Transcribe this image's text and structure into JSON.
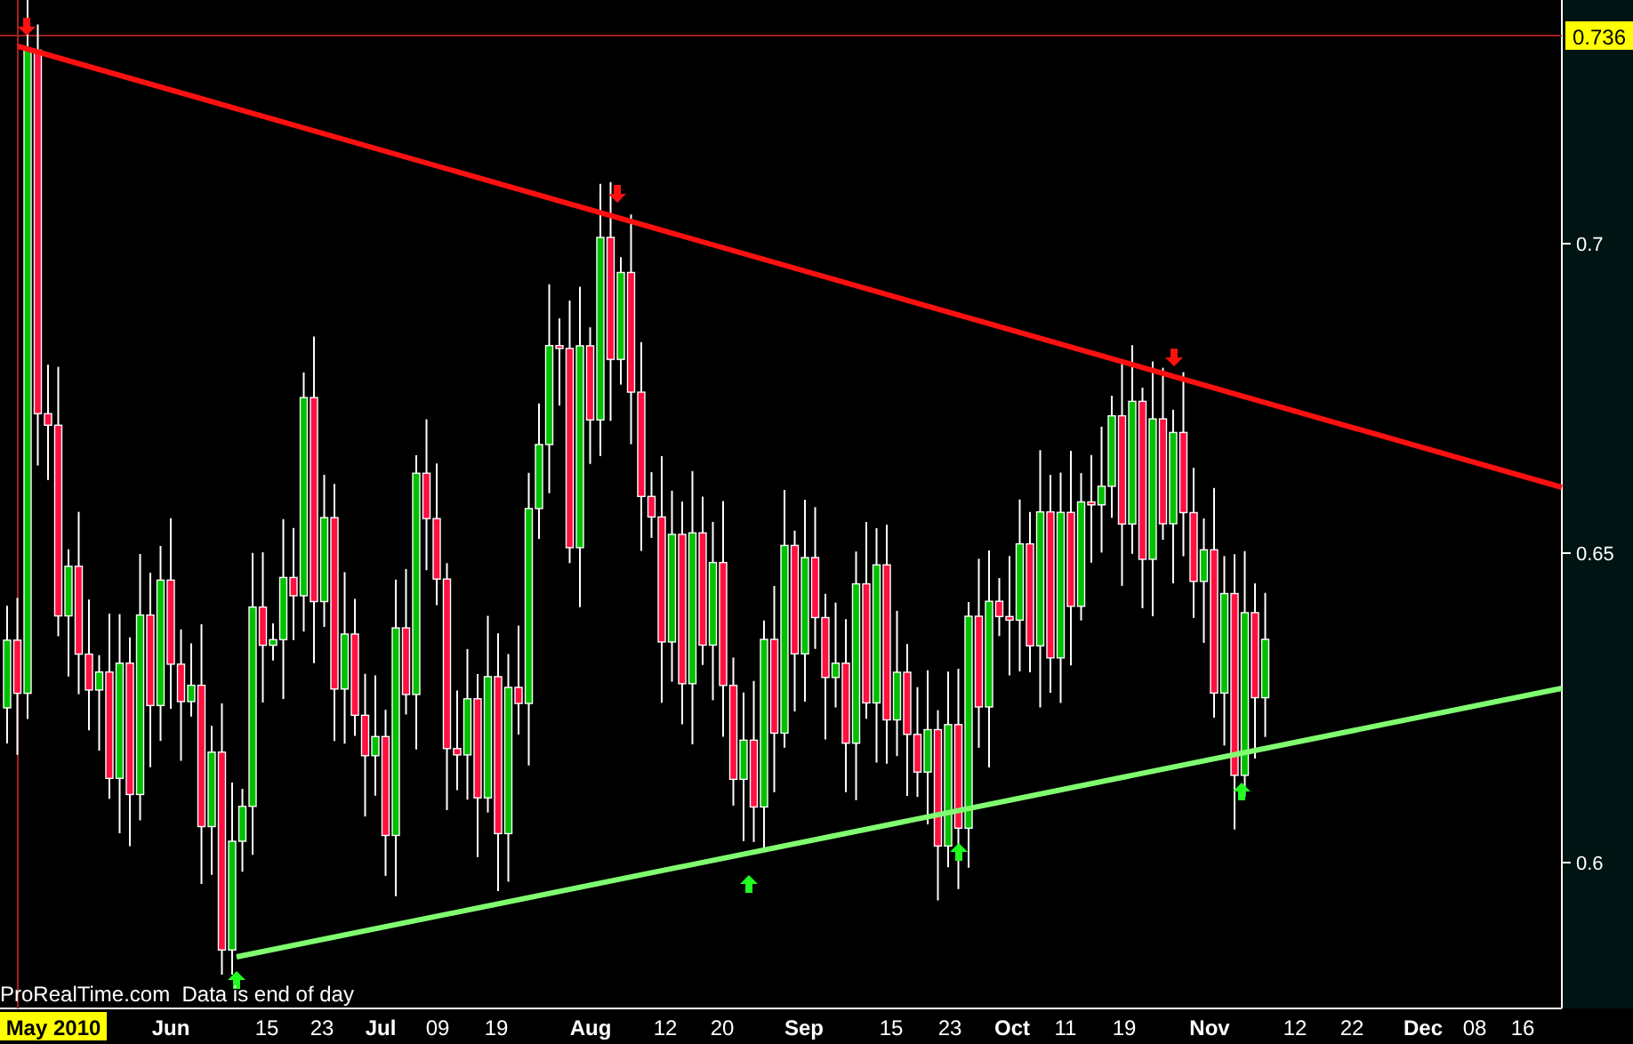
{
  "chart": {
    "price_tag": "0.736",
    "y_ticks": [
      {
        "label": "0.7"
      },
      {
        "label": "0.65"
      },
      {
        "label": "0.6"
      }
    ],
    "x_ticks": [
      {
        "label": "May 2010",
        "selected": true,
        "kind": "month"
      },
      {
        "label": "Jun",
        "selected": false,
        "kind": "month"
      },
      {
        "label": "15",
        "selected": false,
        "kind": "day"
      },
      {
        "label": "23",
        "selected": false,
        "kind": "day"
      },
      {
        "label": "Jul",
        "selected": false,
        "kind": "month"
      },
      {
        "label": "09",
        "selected": false,
        "kind": "day"
      },
      {
        "label": "19",
        "selected": false,
        "kind": "day"
      },
      {
        "label": "Aug",
        "selected": false,
        "kind": "month"
      },
      {
        "label": "12",
        "selected": false,
        "kind": "day"
      },
      {
        "label": "20",
        "selected": false,
        "kind": "day"
      },
      {
        "label": "Sep",
        "selected": false,
        "kind": "month"
      },
      {
        "label": "15",
        "selected": false,
        "kind": "day"
      },
      {
        "label": "23",
        "selected": false,
        "kind": "day"
      },
      {
        "label": "Oct",
        "selected": false,
        "kind": "month"
      },
      {
        "label": "11",
        "selected": false,
        "kind": "day"
      },
      {
        "label": "19",
        "selected": false,
        "kind": "day"
      },
      {
        "label": "Nov",
        "selected": false,
        "kind": "month"
      },
      {
        "label": "12",
        "selected": false,
        "kind": "day"
      },
      {
        "label": "22",
        "selected": false,
        "kind": "day"
      },
      {
        "label": "Dec",
        "selected": false,
        "kind": "month"
      },
      {
        "label": "08",
        "selected": false,
        "kind": "day"
      },
      {
        "label": "16",
        "selected": false,
        "kind": "day"
      }
    ],
    "footer_note": "ProRealTime.com  Data is end of day"
  }
}
